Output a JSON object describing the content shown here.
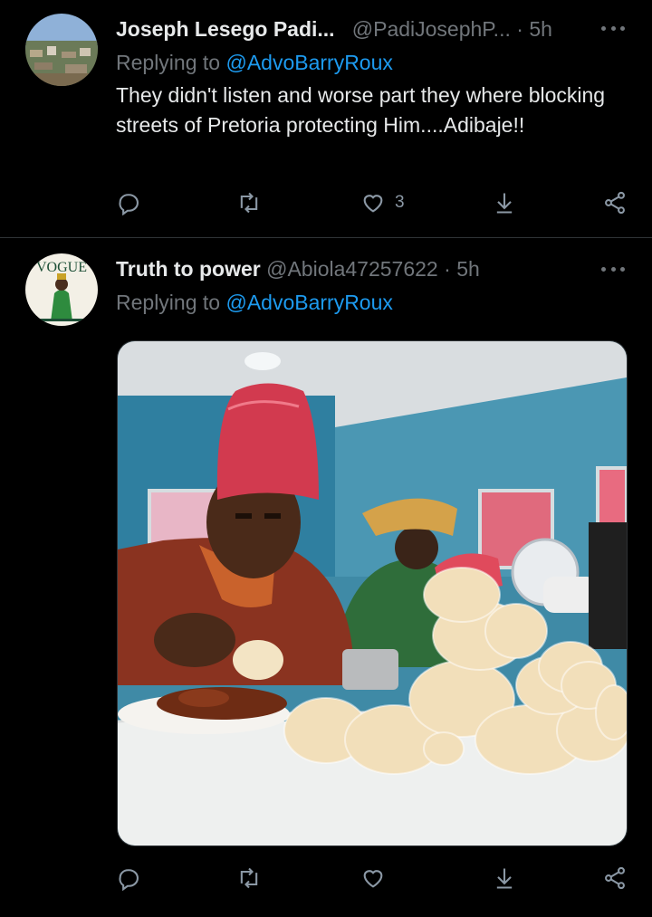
{
  "tweets": [
    {
      "author_name": "Joseph Lesego Padi...",
      "author_handle": "@PadiJosephP...",
      "separator": "·",
      "time": "5h",
      "replying_prefix": "Replying to ",
      "replying_to": "@AdvoBarryRoux",
      "text": "They didn't listen and worse part they where blocking streets of Pretoria protecting Him....Adibaje!!",
      "actions": {
        "reply_count": "",
        "retweet_count": "",
        "like_count": "3"
      }
    },
    {
      "author_name": "Truth to power",
      "author_handle": "@Abiola47257622",
      "separator": "·",
      "time": "5h",
      "replying_prefix": "Replying to ",
      "replying_to": "@AdvoBarryRoux",
      "avatar_text": "VOGUE",
      "actions": {
        "reply_count": "",
        "retweet_count": "",
        "like_count": ""
      }
    }
  ],
  "icons": [
    "reply-icon",
    "retweet-icon",
    "like-icon",
    "download-icon",
    "share-icon",
    "more-icon"
  ],
  "colors": {
    "background": "#000000",
    "text": "#e7e9ea",
    "secondary": "#71767b",
    "link": "#1d9bf0",
    "divider": "#2f3336"
  }
}
